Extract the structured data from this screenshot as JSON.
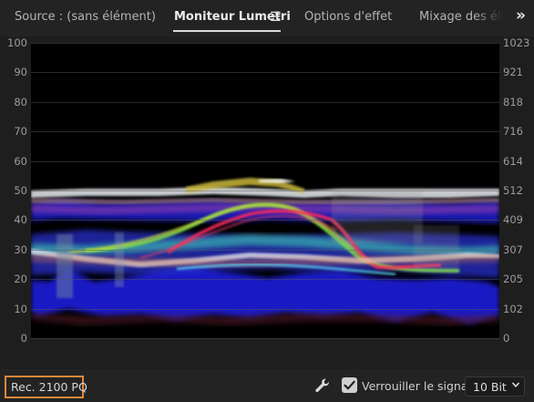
{
  "tabs": [
    {
      "label": "Source : (sans élément)",
      "active": false
    },
    {
      "label": "Moniteur Lumetri",
      "active": true
    },
    {
      "label": "Options d'effet",
      "active": false
    },
    {
      "label": "Mixage des élé",
      "active": false
    }
  ],
  "icons": {
    "menu": "hamburger-menu-icon",
    "overflow": "double-chevron-right-icon",
    "wrench": "wrench-icon",
    "dropdown": "chevron-down-icon"
  },
  "scope": {
    "left_ticks": [
      "100",
      "90",
      "80",
      "70",
      "60",
      "50",
      "40",
      "30",
      "20",
      "10",
      "0"
    ],
    "right_ticks": [
      "1023",
      "921",
      "818",
      "716",
      "614",
      "512",
      "409",
      "307",
      "205",
      "102",
      "0"
    ]
  },
  "footer": {
    "color_space": "Rec. 2100 PQ",
    "lock_signal_label": "Verrouiller le signal",
    "lock_signal_checked": true,
    "bit_depth": "10 Bit"
  },
  "colors": {
    "accent_outline": "#e0883a",
    "background": "#232323",
    "plot_background": "#000000"
  }
}
